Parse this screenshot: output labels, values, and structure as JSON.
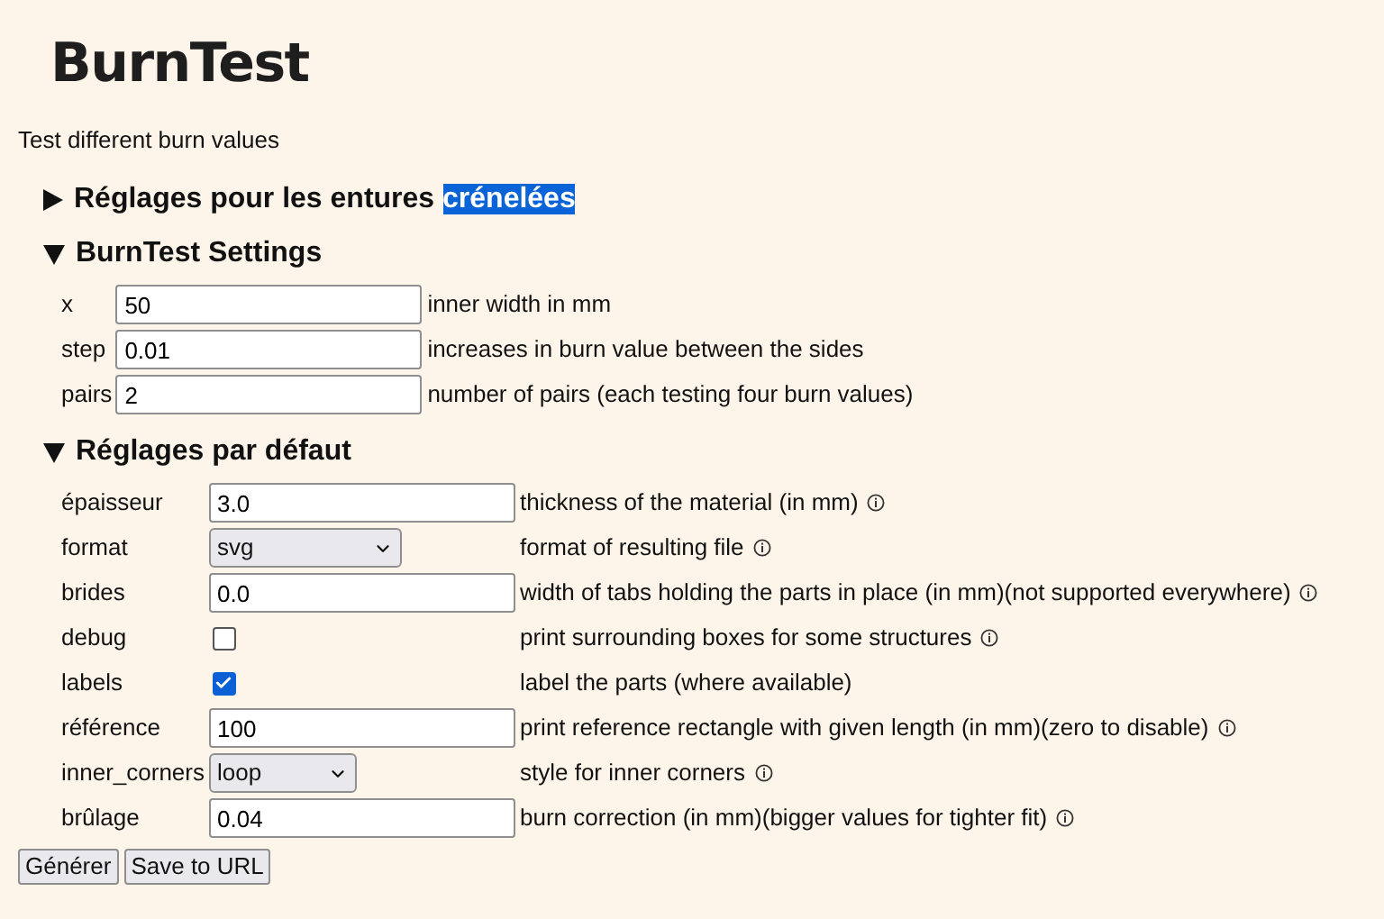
{
  "title": "BurnTest",
  "subtitle": "Test different burn values",
  "sections": [
    {
      "title": "Réglages pour les entures",
      "selected_text": "crénelées",
      "expanded": false
    },
    {
      "title": "BurnTest Settings",
      "expanded": true,
      "rows": [
        {
          "kind": "text",
          "label": "x",
          "value": "50",
          "help": "inner width in mm",
          "info": false
        },
        {
          "kind": "text",
          "label": "step",
          "value": "0.01",
          "help": "increases in burn value between the sides",
          "info": false
        },
        {
          "kind": "text",
          "label": "pairs",
          "value": "2",
          "help": "number of pairs (each testing four burn values)",
          "info": false
        }
      ]
    },
    {
      "title": "Réglages par défaut",
      "expanded": true,
      "rows": [
        {
          "kind": "text",
          "label": "épaisseur",
          "value": "3.0",
          "help": "thickness of the material (in mm)",
          "info": true
        },
        {
          "kind": "select",
          "label": "format",
          "value": "svg",
          "help": "format of resulting file",
          "info": true
        },
        {
          "kind": "text",
          "label": "brides",
          "value": "0.0",
          "help": "width of tabs holding the parts in place (in mm)(not supported everywhere)",
          "info": true
        },
        {
          "kind": "checkbox",
          "label": "debug",
          "checked": false,
          "help": "print surrounding boxes for some structures",
          "info": true
        },
        {
          "kind": "checkbox",
          "label": "labels",
          "checked": true,
          "help": "label the parts (where available)",
          "info": false
        },
        {
          "kind": "text",
          "label": "référence",
          "value": "100",
          "help": "print reference rectangle with given length (in mm)(zero to disable)",
          "info": true
        },
        {
          "kind": "select",
          "label": "inner_corners",
          "value": "loop",
          "help": "style for inner corners",
          "info": true
        },
        {
          "kind": "text",
          "label": "brûlage",
          "value": "0.04",
          "help": "burn correction (in mm)(bigger values for tighter fit)",
          "info": true
        }
      ]
    }
  ],
  "buttons": [
    "Générer",
    "Save to URL"
  ]
}
